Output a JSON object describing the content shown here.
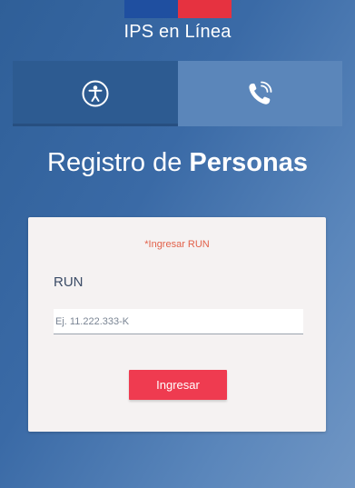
{
  "header": {
    "brand": "IPS en Línea"
  },
  "tabs": [
    {
      "icon": "accessibility-icon"
    },
    {
      "icon": "phone-icon"
    }
  ],
  "page": {
    "title_regular": "Registro de ",
    "title_bold": "Personas"
  },
  "form": {
    "error_text": "*Ingresar RUN",
    "run_label": "RUN",
    "run_placeholder": "Ej. 11.222.333-K",
    "run_value": "",
    "submit_label": "Ingresar"
  },
  "colors": {
    "flag_blue": "#1f4fa0",
    "flag_red": "#e63240",
    "error": "#e2614a",
    "button": "#ef3b50"
  }
}
